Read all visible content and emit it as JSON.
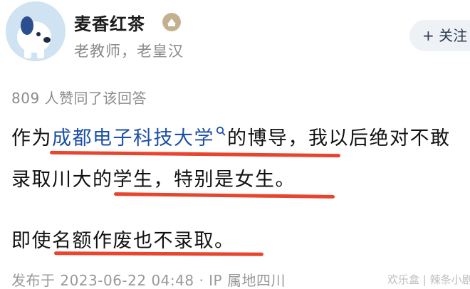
{
  "author": {
    "name": "麦香红茶",
    "bio": "老教师，老皇汉",
    "badge_icon": "badge-icon",
    "avatar_icon": "dog-avatar-icon"
  },
  "follow_button": {
    "label": "+ 关注"
  },
  "likes_text": "809 人赞同了该回答",
  "content": {
    "line1_prefix": "作为",
    "line1_link": "成都电子科技大学",
    "line1_suffix": "的博导，我以后绝对不敢",
    "line2": "录取川大的学生，特别是女生。",
    "line3": "即使名额作废也不录取。",
    "link_color": "#1b4fa8",
    "underline_color": "#e8452f"
  },
  "footer": {
    "published": "发布于 2023-06-22 04:48 · IP 属地四川"
  },
  "watermark": "欢乐盒 | 辣条小剧场"
}
